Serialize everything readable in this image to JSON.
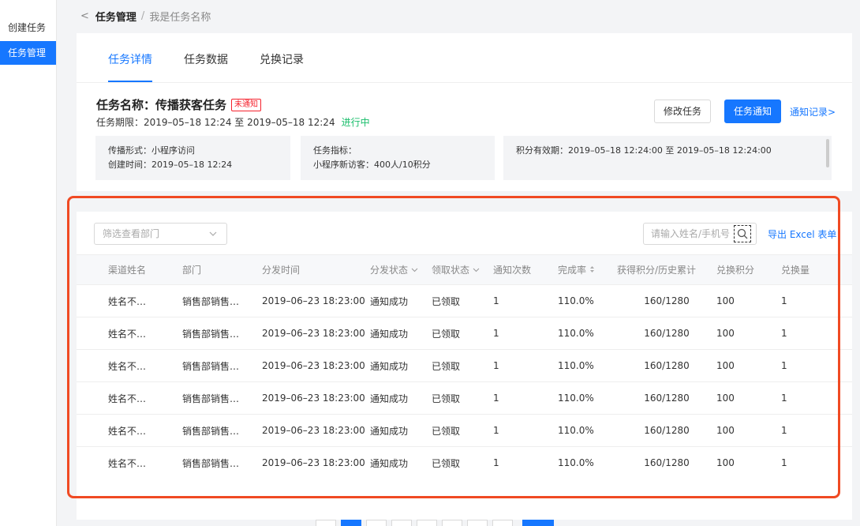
{
  "sidebar": {
    "items": [
      {
        "label": "创建任务"
      },
      {
        "label": "任务管理"
      }
    ]
  },
  "breadcrumb": {
    "back": "<",
    "current": "任务管理",
    "sep": "/",
    "name": "我是任务名称"
  },
  "tabs": [
    {
      "label": "任务详情"
    },
    {
      "label": "任务数据"
    },
    {
      "label": "兑换记录"
    }
  ],
  "task": {
    "title": "任务名称：传播获客任务",
    "tag": "未通知",
    "period": "任务期限：2019–05–18 12:24 至 2019–05–18 12:24",
    "status": "进行中",
    "edit_label": "修改任务",
    "notify_label": "任务通知",
    "record_link": "通知记录>"
  },
  "info": {
    "spread": "传播形式：小程序访问",
    "created": "创建时间：2019–05–18 12:24",
    "target_label": "任务指标：",
    "target_value": "小程序新访客：400人/10积分",
    "validity": "积分有效期：2019–05–18 12:24:00 至 2019–05–18 12:24:00"
  },
  "filters": {
    "dept_placeholder": "筛选查看部门",
    "search_placeholder": "请输入姓名/手机号",
    "export_label": "导出 Excel 表单"
  },
  "table": {
    "headers": [
      "渠道姓名",
      "部门",
      "分发时间",
      "分发状态",
      "领取状态",
      "通知次数",
      "完成率",
      "获得积分/历史累计",
      "兑换积分",
      "兑换量"
    ],
    "rows": [
      [
        "姓名不…",
        "销售部销售…",
        "2019–06–23 18:23:00",
        "通知成功",
        "已领取",
        "1",
        "110.0%",
        "160/1280",
        "100",
        "1"
      ],
      [
        "姓名不…",
        "销售部销售…",
        "2019–06–23 18:23:00",
        "通知成功",
        "已领取",
        "1",
        "110.0%",
        "160/1280",
        "100",
        "1"
      ],
      [
        "姓名不…",
        "销售部销售…",
        "2019–06–23 18:23:00",
        "通知成功",
        "已领取",
        "1",
        "110.0%",
        "160/1280",
        "100",
        "1"
      ],
      [
        "姓名不…",
        "销售部销售…",
        "2019–06–23 18:23:00",
        "通知成功",
        "已领取",
        "1",
        "110.0%",
        "160/1280",
        "100",
        "1"
      ],
      [
        "姓名不…",
        "销售部销售…",
        "2019–06–23 18:23:00",
        "通知成功",
        "已领取",
        "1",
        "110.0%",
        "160/1280",
        "100",
        "1"
      ],
      [
        "姓名不…",
        "销售部销售…",
        "2019–06–23 18:23:00",
        "通知成功",
        "已领取",
        "1",
        "110.0%",
        "160/1280",
        "100",
        "1"
      ]
    ]
  },
  "colors": {
    "accent": "#1677ff",
    "highlight": "#f04a23",
    "success": "#19be6b",
    "danger": "#f5222d"
  }
}
